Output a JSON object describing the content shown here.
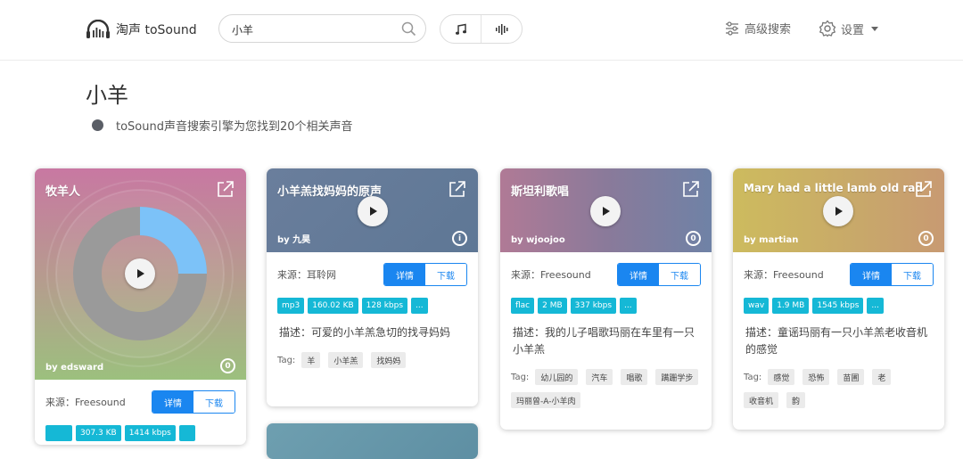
{
  "header": {
    "logo_text": "淘声 toSound",
    "search_value": "小羊",
    "music_mode_icon": "music-note-icon",
    "sound_mode_icon": "waveform-icon",
    "advanced_search_label": "高级搜索",
    "settings_label": "设置"
  },
  "results": {
    "query": "小羊",
    "summary": "toSound声音搜索引擎为您找到20个相关声音"
  },
  "common": {
    "details_label": "详情",
    "download_label": "下载",
    "tag_label": "Tag:"
  },
  "cards": [
    {
      "title": "牧羊人",
      "author": "by edsward",
      "source": "来源：Freesound",
      "badges": [
        "307.3 KB",
        "1414 kbps"
      ],
      "waveform_fraction": 0.25,
      "accent": "#7cc2f8"
    },
    {
      "title": "小羊羔找妈妈的原声",
      "author": "by 九昊",
      "source": "来源：耳聆网",
      "badges": [
        "mp3",
        "160.02 KB",
        "128 kbps",
        "..."
      ],
      "description": "描述：可爱的小羊羔急切的找寻妈妈",
      "tags": [
        "羊",
        "小羊羔",
        "找妈妈"
      ]
    },
    {
      "title": "斯坦利歌唱",
      "author": "by wjoojoo",
      "source": "来源：Freesound",
      "badges": [
        "flac",
        "2 MB",
        "337 kbps",
        "..."
      ],
      "description": "描述：我的儿子唱歌玛丽在车里有一只小羊羔",
      "tags": [
        "幼儿园的",
        "汽车",
        "唱歌",
        "蹒跚学步",
        "玛丽曾-A-小羊肉"
      ]
    },
    {
      "title": "Mary had a little lamb old rad",
      "author": "by martian",
      "source": "来源：Freesound",
      "badges": [
        "wav",
        "1.9 MB",
        "1545 kbps",
        "..."
      ],
      "description": "描述：童谣玛丽有一只小羊羔老收音机的感觉",
      "tags": [
        "感觉",
        "恐怖",
        "苗圃",
        "老",
        "收音机",
        "韵"
      ]
    }
  ]
}
